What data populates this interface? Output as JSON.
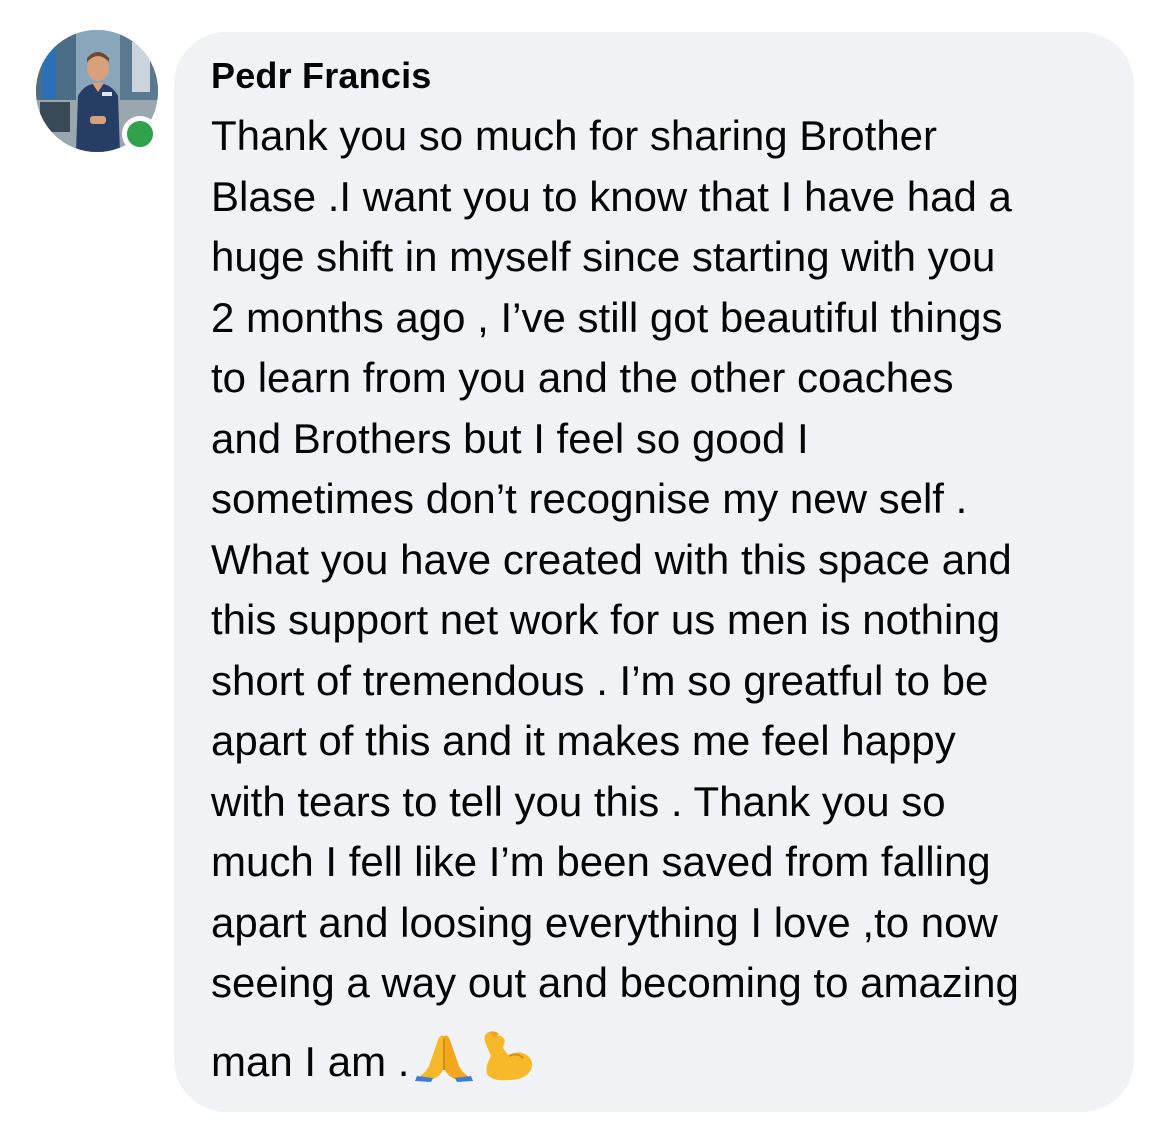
{
  "comment": {
    "author": "Pedr Francis",
    "author_online": true,
    "text_lines": [
      "Thank you so much for sharing Brother",
      "Blase .I want you to know that I have had a",
      "huge shift in myself since starting with you",
      "2 months ago , I’ve still got beautiful things",
      "to learn from you and the other coaches",
      "and Brothers but I feel so good I",
      "sometimes don’t recognise my new self .",
      "What you have created with this space and",
      "this support net work for us men is nothing",
      "short of tremendous . I’m so greatful to be",
      "apart of this and it makes me feel happy",
      "with tears to tell you this . Thank you so",
      "much I fell like I’m been  saved from falling",
      "apart and loosing everything I love ,to now",
      "seeing a way out and becoming to amazing",
      "man I am ."
    ],
    "emojis": [
      "folded-hands-icon",
      "flexed-biceps-icon"
    ]
  },
  "colors": {
    "bubble_bg": "#f0f2f5",
    "text": "#050505",
    "online": "#31a24c"
  }
}
